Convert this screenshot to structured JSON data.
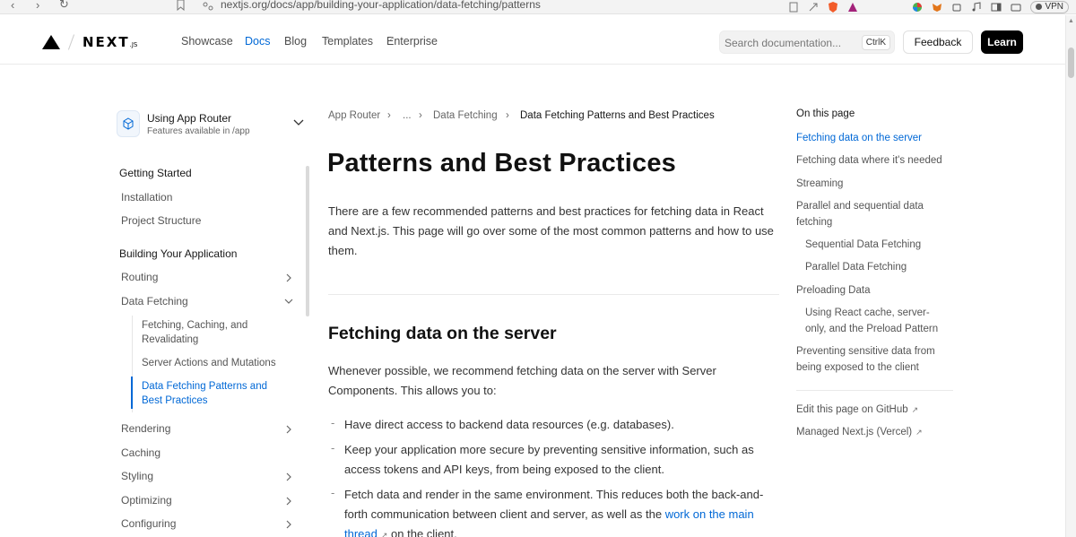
{
  "browser": {
    "url": "nextjs.org/docs/app/building-your-application/data-fetching/patterns",
    "vpn_label": "VPN"
  },
  "header": {
    "logo_text": "NEXT",
    "logo_suffix": ".JS",
    "nav": [
      {
        "label": "Showcase",
        "external": false,
        "active": false
      },
      {
        "label": "Docs",
        "external": false,
        "active": true
      },
      {
        "label": "Blog",
        "external": false,
        "active": false
      },
      {
        "label": "Templates",
        "external": true,
        "active": false
      },
      {
        "label": "Enterprise",
        "external": true,
        "active": false
      }
    ],
    "external_mark": "↗",
    "search_placeholder": "Search documentation...",
    "search_shortcut": "CtrlK",
    "feedback_label": "Feedback",
    "learn_label": "Learn"
  },
  "sidebar": {
    "router_title": "Using App Router",
    "router_subtitle": "Features available in /app",
    "getting_started": {
      "heading": "Getting Started",
      "items": [
        "Installation",
        "Project Structure"
      ]
    },
    "building": {
      "heading": "Building Your Application",
      "routing": "Routing",
      "data_fetching": "Data Fetching",
      "data_fetching_children": [
        "Fetching, Caching, and Revalidating",
        "Server Actions and Mutations",
        "Data Fetching Patterns and Best Practices"
      ],
      "rest": [
        "Rendering",
        "Caching",
        "Styling",
        "Optimizing",
        "Configuring"
      ]
    }
  },
  "breadcrumb": {
    "items": [
      "App Router",
      "...",
      "Data Fetching",
      "Data Fetching Patterns and Best Practices"
    ],
    "separator": "›"
  },
  "main": {
    "title": "Patterns and Best Practices",
    "intro_lines": [
      "There are a few recommended patterns and best practices for fetching data in React",
      "and Next.js. This page will go over some of the most common patterns and how to use",
      "them."
    ],
    "section_title": "Fetching data on the server",
    "section_intro_lines": [
      "Whenever possible, we recommend fetching data on the server with Server",
      "Components. This allows you to:"
    ],
    "bullet_marker": "-",
    "bullets": {
      "b1_line1": "Have direct access to backend data resources (e.g. databases).",
      "b2_line1": "Keep your application more secure by preventing sensitive information, such as",
      "b2_line2": "access tokens and API keys, from being exposed to the client.",
      "b3_line1": "Fetch data and render in the same environment. This reduces both the back-and-",
      "b3_line2_text": "forth communication between client and server, as well as the ",
      "b3_link1": "work on the main",
      "b3_link2": "thread",
      "b3_line3_rest": " on the client."
    }
  },
  "toc": {
    "title": "On this page",
    "items": [
      {
        "label": "Fetching data on the server",
        "active": true
      },
      {
        "label": "Fetching data where it's needed",
        "active": false
      },
      {
        "label": "Streaming",
        "active": false
      },
      {
        "label": "Parallel and sequential data fetching",
        "active": false
      },
      {
        "label": "Sequential Data Fetching",
        "active": false
      },
      {
        "label": "Parallel Data Fetching",
        "active": false
      },
      {
        "label": "Preloading Data",
        "active": false
      },
      {
        "label": "Using React cache, server-only, and the Preload Pattern",
        "active": false
      },
      {
        "label": "Preventing sensitive data from being exposed to the client",
        "active": false
      }
    ],
    "edit_github": "Edit this page on GitHub",
    "managed": "Managed Next.js (Vercel)",
    "external_mark": "↗"
  }
}
